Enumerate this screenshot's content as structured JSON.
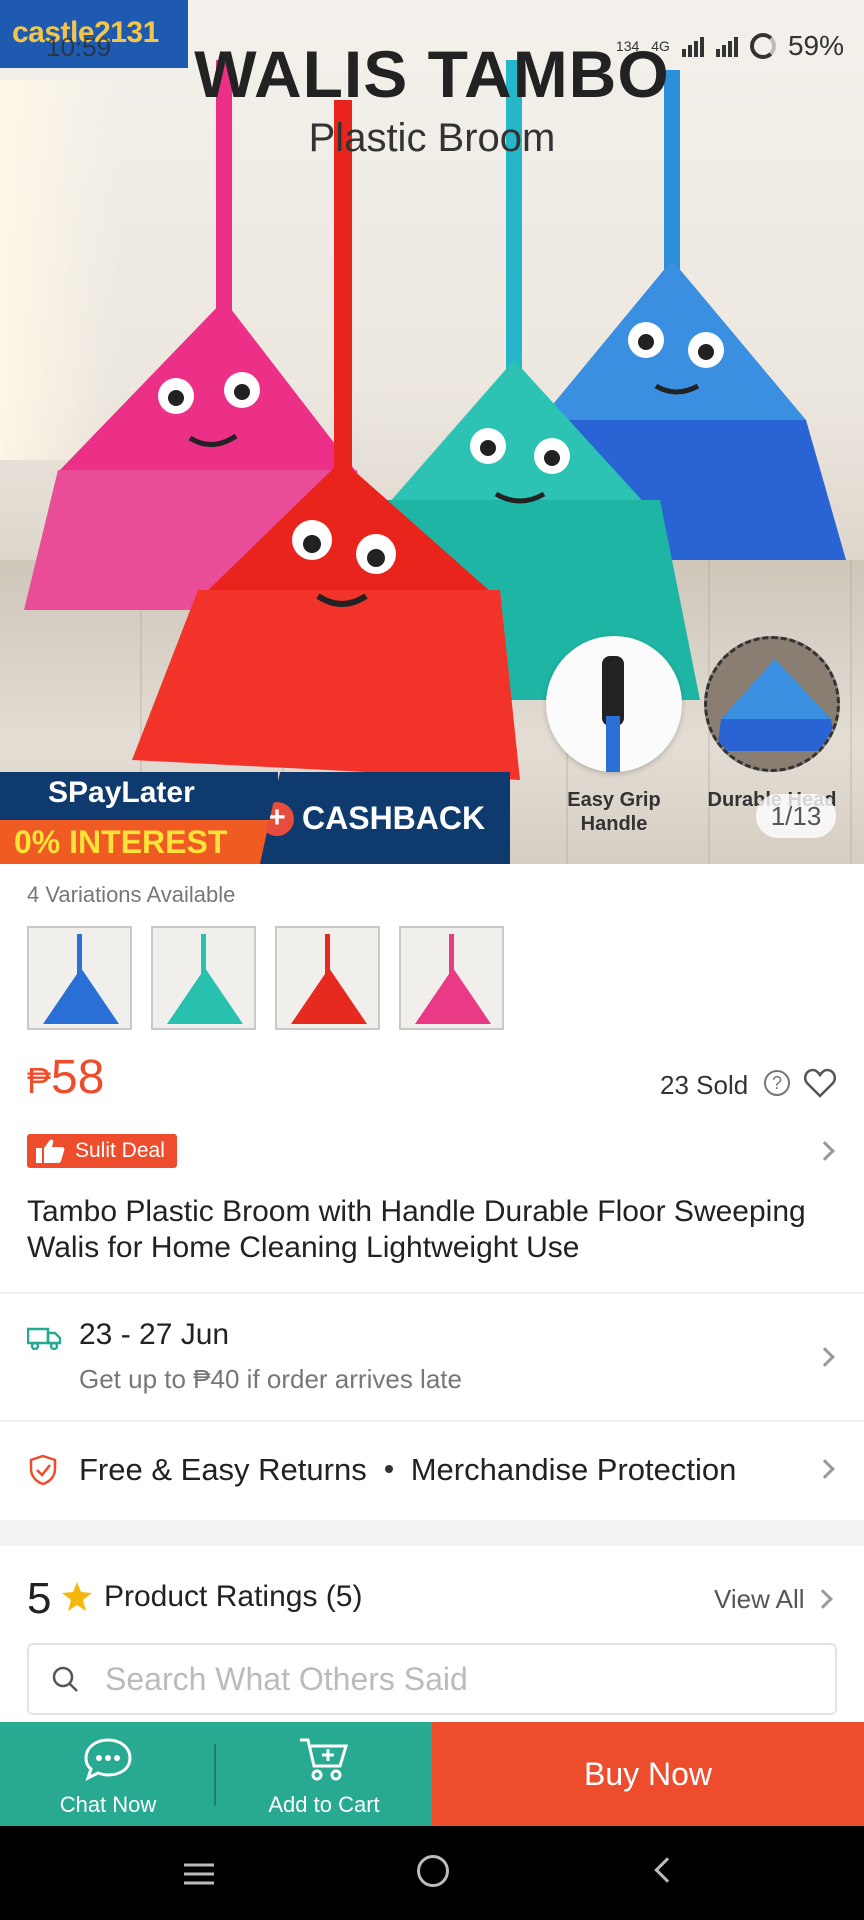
{
  "status_bar": {
    "time": "10:59",
    "network": "4G",
    "speed": "134",
    "battery": "59%"
  },
  "hero": {
    "watermark": "castle2131",
    "title": "WALIS TAMBO",
    "subtitle": "Plastic Broom",
    "promo_paylater": "SPayLater",
    "promo_interest": "0% INTEREST",
    "promo_cashback": "CASHBACK",
    "feature_1": "Easy Grip Handle",
    "feature_2": "Durable Head",
    "image_counter": "1/13",
    "broom_colors": [
      "#ec2f87",
      "#e8241c",
      "#2cc3b4",
      "#3a8fe0"
    ]
  },
  "product": {
    "variations_label": "4 Variations Available",
    "variants": [
      {
        "color": "#2a6fd6",
        "icon": "blue-broom"
      },
      {
        "color": "#27c1ad",
        "icon": "teal-broom"
      },
      {
        "color": "#e72a1f",
        "icon": "red-broom"
      },
      {
        "color": "#ea3a86",
        "icon": "pink-broom"
      }
    ],
    "currency": "₱",
    "price": "58",
    "sold": "23 Sold",
    "deal_badge": "Sulit Deal",
    "title": "Tambo Plastic Broom with Handle Durable Floor Sweeping Walis for Home Cleaning Lightweight Use"
  },
  "shipping": {
    "date_range": "23 - 27 Jun",
    "late_note": "Get up to ₱40 if order arrives late"
  },
  "guarantees": {
    "returns": "Free & Easy Returns",
    "protection": "Merchandise Protection"
  },
  "ratings": {
    "score": "5",
    "label": "Product Ratings (5)",
    "view_all": "View All",
    "search_placeholder": "Search What Others Said"
  },
  "actions": {
    "chat": "Chat Now",
    "cart": "Add to Cart",
    "buy": "Buy Now"
  },
  "colors": {
    "accent": "#ee4d2d",
    "teal": "#27aa91"
  }
}
